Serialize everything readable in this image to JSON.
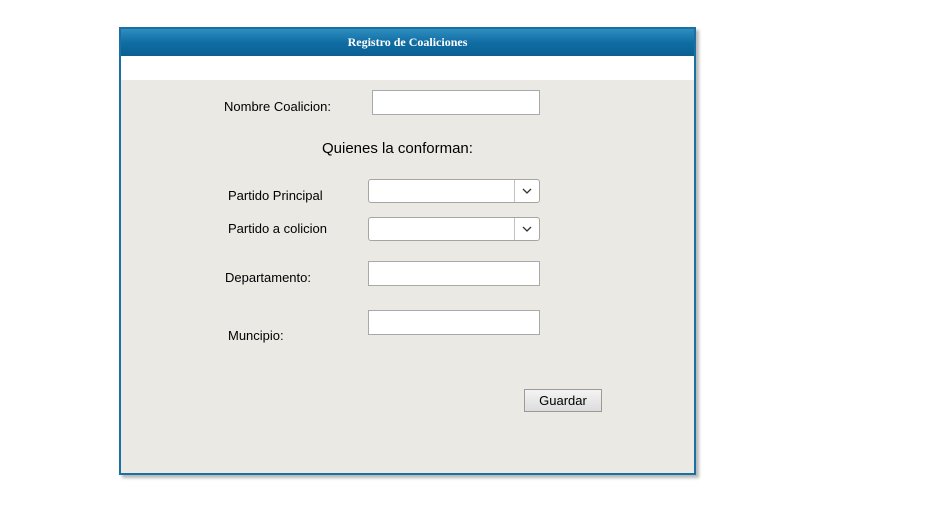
{
  "panel": {
    "title": "Registro de Coaliciones"
  },
  "form": {
    "nombre_label": "Nombre Coalicion:",
    "nombre_value": "",
    "section_title": "Quienes la conforman:",
    "partido_principal_label": "Partido Principal",
    "partido_principal_value": "",
    "partido_coalicion_label": "Partido a colicion",
    "partido_coalicion_value": "",
    "departamento_label": "Departamento:",
    "departamento_value": "",
    "municipio_label": "Muncipio:",
    "municipio_value": "",
    "save_label": "Guardar"
  },
  "icons": {
    "dropdown": "chevron-down-icon"
  },
  "colors": {
    "header_blue": "#0f6da3",
    "panel_border": "#1a6fa3",
    "panel_background": "#ebe9e4"
  }
}
